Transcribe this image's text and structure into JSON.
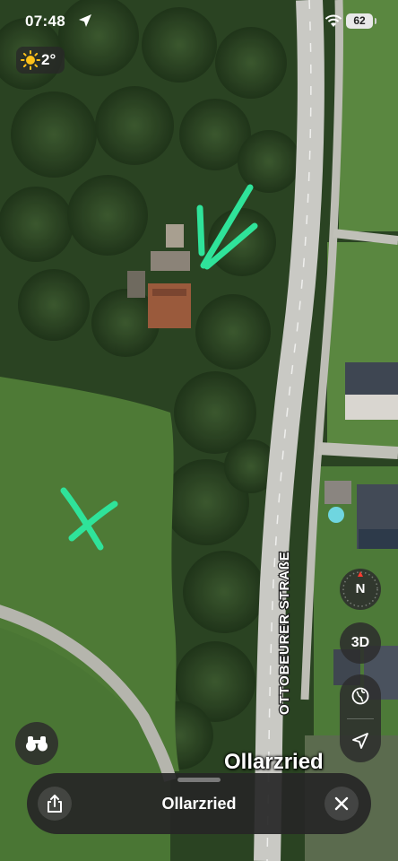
{
  "status_bar": {
    "time": "07:48",
    "battery": "62"
  },
  "weather": {
    "temperature": "2°",
    "icon": "sun-icon"
  },
  "map": {
    "street_label": "OTTOBEURER STRAßE",
    "place_label": "Ollarzried",
    "annotation_marks": [
      "checkmark",
      "x-mark"
    ],
    "annotation_color": "#2fe39a"
  },
  "controls": {
    "compass_label": "N",
    "view_3d_label": "3D",
    "icons": [
      "globe-icon",
      "location-arrow-icon",
      "binoculars-icon"
    ]
  },
  "sheet": {
    "title": "Ollarzried",
    "share_icon": "share-icon",
    "close_icon": "close-icon"
  }
}
